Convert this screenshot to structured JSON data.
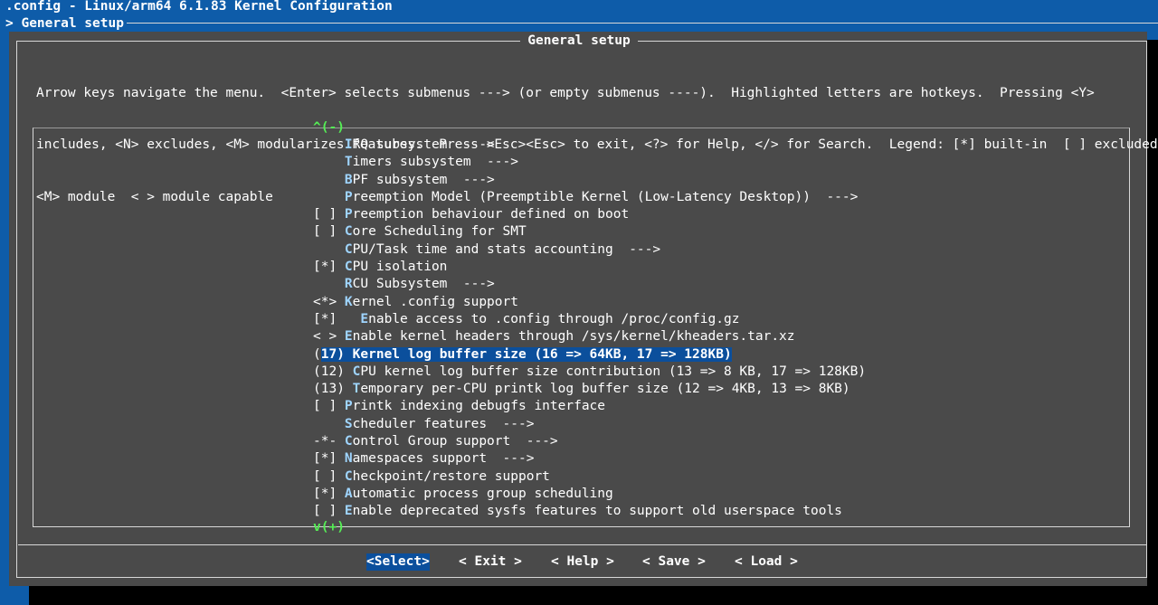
{
  "window": {
    "title": ".config - Linux/arm64 6.1.83 Kernel Configuration",
    "breadcrumb": "> General setup"
  },
  "dialog": {
    "title": "General setup",
    "help_lines": [
      "Arrow keys navigate the menu.  <Enter> selects submenus ---> (or empty submenus ----).  Highlighted letters are hotkeys.  Pressing <Y>",
      "includes, <N> excludes, <M> modularizes features.  Press <Esc><Esc> to exit, <?> for Help, </> for Search.  Legend: [*] built-in  [ ] excluded",
      "<M> module  < > module capable"
    ]
  },
  "scroll": {
    "up": "^(-)",
    "down": "v(+)"
  },
  "menu_items": [
    {
      "prefix": "    ",
      "hotkey": "I",
      "rest": "RQ subsystem  --->",
      "selected": false
    },
    {
      "prefix": "    ",
      "hotkey": "T",
      "rest": "imers subsystem  --->",
      "selected": false
    },
    {
      "prefix": "    ",
      "hotkey": "B",
      "rest": "PF subsystem  --->",
      "selected": false
    },
    {
      "prefix": "    ",
      "hotkey": "P",
      "rest": "reemption Model (Preemptible Kernel (Low-Latency Desktop))  --->",
      "selected": false
    },
    {
      "prefix": "[ ] ",
      "hotkey": "P",
      "rest": "reemption behaviour defined on boot",
      "selected": false
    },
    {
      "prefix": "[ ] ",
      "hotkey": "C",
      "rest": "ore Scheduling for SMT",
      "selected": false
    },
    {
      "prefix": "    ",
      "hotkey": "C",
      "rest": "PU/Task time and stats accounting  --->",
      "selected": false
    },
    {
      "prefix": "[*] ",
      "hotkey": "C",
      "rest": "PU isolation",
      "selected": false
    },
    {
      "prefix": "    ",
      "hotkey": "R",
      "rest": "CU Subsystem  --->",
      "selected": false
    },
    {
      "prefix": "<*> ",
      "hotkey": "K",
      "rest": "ernel .config support",
      "selected": false
    },
    {
      "prefix": "[*]   ",
      "hotkey": "E",
      "rest": "nable access to .config through /proc/config.gz",
      "selected": false
    },
    {
      "prefix": "< > ",
      "hotkey": "E",
      "rest": "nable kernel headers through /sys/kernel/kheaders.tar.xz",
      "selected": false
    },
    {
      "prefix": "(17) ",
      "hotkey": "K",
      "rest": "ernel log buffer size (16 => 64KB, 17 => 128KB)",
      "selected": true
    },
    {
      "prefix": "(12) ",
      "hotkey": "C",
      "rest": "PU kernel log buffer size contribution (13 => 8 KB, 17 => 128KB)",
      "selected": false
    },
    {
      "prefix": "(13) ",
      "hotkey": "T",
      "rest": "emporary per-CPU printk log buffer size (12 => 4KB, 13 => 8KB)",
      "selected": false
    },
    {
      "prefix": "[ ] ",
      "hotkey": "P",
      "rest": "rintk indexing debugfs interface",
      "selected": false
    },
    {
      "prefix": "    ",
      "hotkey": "S",
      "rest": "cheduler features  --->",
      "selected": false
    },
    {
      "prefix": "-*- ",
      "hotkey": "C",
      "rest": "ontrol Group support  --->",
      "selected": false
    },
    {
      "prefix": "[*] ",
      "hotkey": "N",
      "rest": "amespaces support  --->",
      "selected": false
    },
    {
      "prefix": "[ ] ",
      "hotkey": "C",
      "rest": "heckpoint/restore support",
      "selected": false
    },
    {
      "prefix": "[*] ",
      "hotkey": "A",
      "rest": "utomatic process group scheduling",
      "selected": false
    },
    {
      "prefix": "[ ] ",
      "hotkey": "E",
      "rest": "nable deprecated sysfs features to support old userspace tools",
      "selected": false
    }
  ],
  "buttons": [
    {
      "label": "<Select>",
      "active": true
    },
    {
      "label": "< Exit >",
      "active": false
    },
    {
      "label": "< Help >",
      "active": false
    },
    {
      "label": "< Save >",
      "active": false
    },
    {
      "label": "< Load >",
      "active": false
    }
  ],
  "colors": {
    "background": "#0e5ca9",
    "dialog": "#4a4a4a",
    "highlight": "#0b4f9c",
    "scroll_indicator": "#55ee55"
  }
}
